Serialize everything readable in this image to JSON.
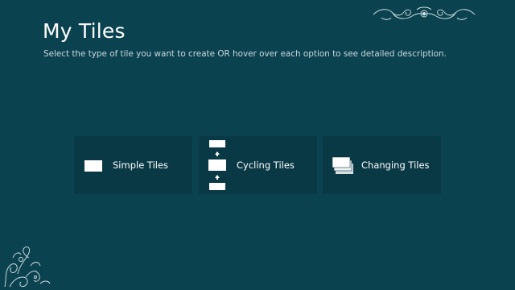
{
  "header": {
    "title": "My Tiles",
    "subtitle": "Select the type of tile you want to create OR hover over each option to see detailed description."
  },
  "tiles": [
    {
      "label": "Simple Tiles",
      "icon": "simple-tile-icon"
    },
    {
      "label": "Cycling Tiles",
      "icon": "cycling-tiles-icon"
    },
    {
      "label": "Changing Tiles",
      "icon": "changing-tiles-icon"
    }
  ],
  "colors": {
    "background": "#0b4250",
    "tile": "#0a3946",
    "text": "#ffffff",
    "subtitle": "#c9d8dc"
  }
}
